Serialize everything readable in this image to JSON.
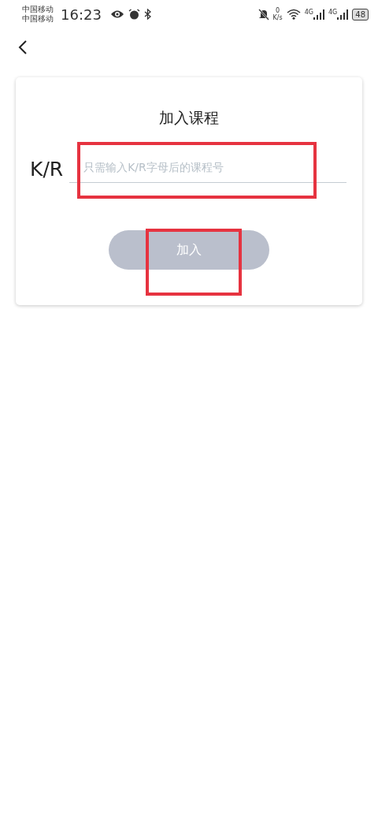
{
  "status_bar": {
    "carriers": [
      "中国移动",
      "中国移动"
    ],
    "time": "16:23",
    "speed_value": "0",
    "speed_unit": "K/s",
    "signals": [
      {
        "label": "4G"
      },
      {
        "label": "4G"
      }
    ],
    "battery": "48"
  },
  "card": {
    "title": "加入课程",
    "prefix": "K/R",
    "field": {
      "placeholder": "只需输入K/R字母后的课程号",
      "highlighted": true
    },
    "button": {
      "label": "加入",
      "disabled": true,
      "highlighted": true
    }
  }
}
